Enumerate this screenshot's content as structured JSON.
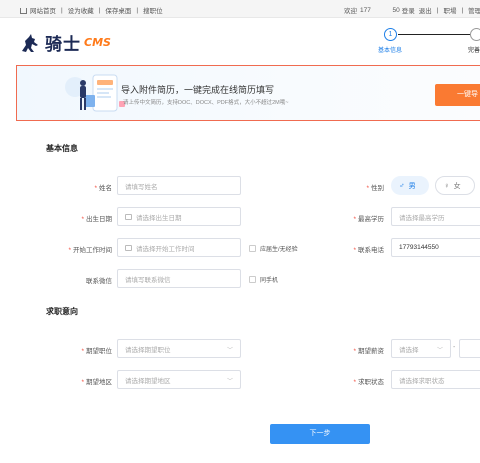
{
  "topbar": {
    "links": [
      "网站首页",
      "设为收藏",
      "保存桌面",
      "搜职位"
    ],
    "welcome": "欢迎",
    "phone_masked": "177            50",
    "login_status": "登录",
    "logout": "退出",
    "recruit": "职場",
    "admin": "管理中"
  },
  "header": {
    "brand": "骑士",
    "brand_suffix": "CMS",
    "steps": [
      {
        "num": "1",
        "label": "基本信息",
        "active": true
      },
      {
        "num": "",
        "label": "完善",
        "active": false
      }
    ]
  },
  "banner": {
    "title": "导入附件简历，一键完成在线简历填写",
    "subtitle": "请上传中文简历，支持DOC、DOCX、PDF格式，大小不超过2M哦~",
    "button": "一键导"
  },
  "basic": {
    "title": "基本信息",
    "name_label": "姓名",
    "name_placeholder": "请填写姓名",
    "gender_label": "性别",
    "gender_male": "男",
    "gender_female": "女",
    "birth_label": "出生日期",
    "birth_placeholder": "请选择出生日期",
    "education_label": "最高学历",
    "education_placeholder": "请选择最高学历",
    "work_start_label": "开始工作时间",
    "work_start_placeholder": "请选择开始工作时间",
    "fresh_grad_label": "应届生/无经验",
    "phone_label": "联系电话",
    "phone_value": "17793144550",
    "wechat_label": "联系微信",
    "wechat_placeholder": "请填写联系微信",
    "same_phone_label": "同手机"
  },
  "intent": {
    "title": "求职意向",
    "position_label": "期望职位",
    "position_placeholder": "请选择期望职位",
    "salary_label": "期望薪资",
    "salary_placeholder": "请选择",
    "area_label": "期望地区",
    "area_placeholder": "请选择期望地区",
    "status_label": "求职状态",
    "status_placeholder": "请选择求职状态"
  },
  "next_button": "下一步",
  "colors": {
    "accent_blue": "#1e7fe8",
    "banner_orange": "#fa7a32",
    "required_red": "#f24c3d",
    "banner_border": "#f06b50"
  }
}
